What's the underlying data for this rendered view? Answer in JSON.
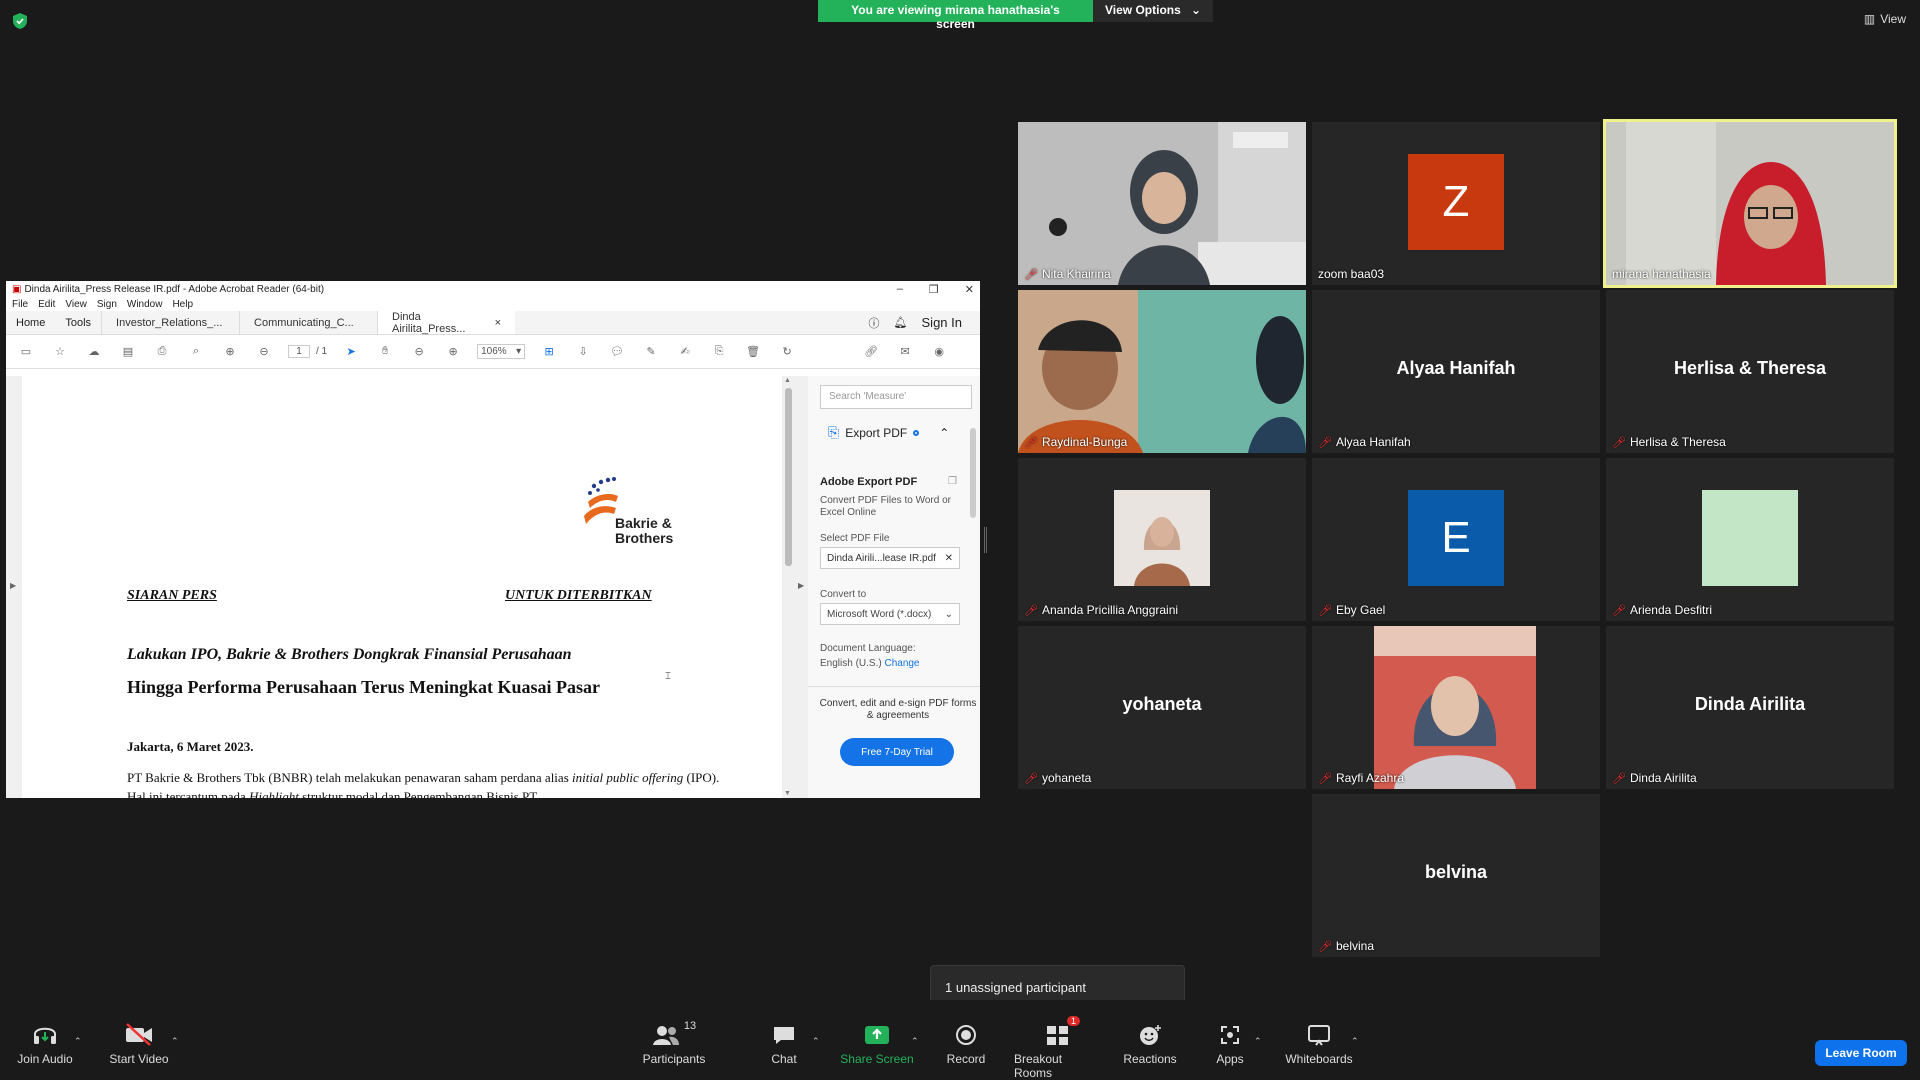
{
  "banner": {
    "viewing_text": "You are viewing mirana hanathasia's screen",
    "view_options": "View Options",
    "view_button": "View"
  },
  "acrobat": {
    "title": "Dinda Airilita_Press Release IR.pdf - Adobe Acrobat Reader (64-bit)",
    "menu": [
      "File",
      "Edit",
      "View",
      "Sign",
      "Window",
      "Help"
    ],
    "home": "Home",
    "tools": "Tools",
    "tabs": [
      "Investor_Relations_...",
      "Communicating_C...",
      "Dinda Airilita_Press..."
    ],
    "sign_in": "Sign In",
    "page_current": "1",
    "page_total": "/ 1",
    "zoom": "106%",
    "document": {
      "logo_line1": "Bakrie &",
      "logo_line2": "Brothers",
      "left_heading": "SIARAN PERS",
      "right_heading": "UNTUK DITERBITKAN",
      "headline1": "Lakukan IPO, Bakrie & Brothers Dongkrak  Finansial Perusahaan",
      "headline2": "Hingga Performa Perusahaan Terus Meningkat Kuasai Pasar",
      "dateline": "Jakarta, 6 Maret 2023.",
      "body_a": "PT Bakrie & Brothers Tbk (BNBR) telah melakukan penawaran saham perdana alias ",
      "body_b": "initial public offering",
      "body_c": " (IPO). Hal ini tercantum pada ",
      "body_d": "Highlight",
      "body_e": " struktur modal dan Pengembangan Bisnis PT"
    },
    "panel": {
      "search_placeholder": "Search 'Measure'",
      "export_pdf": "Export PDF",
      "adobe_export_title": "Adobe Export PDF",
      "adobe_export_desc": "Convert PDF Files to Word or Excel Online",
      "select_pdf": "Select PDF File",
      "file_name": "Dinda Airili...lease IR.pdf",
      "convert_to": "Convert to",
      "convert_value": "Microsoft Word (*.docx)",
      "doc_language": "Document Language:",
      "language": "English (U.S.)",
      "change": "Change",
      "promo": "Convert, edit and e-sign PDF forms & agreements",
      "trial": "Free 7-Day Trial"
    }
  },
  "participants": [
    {
      "name": "Nita Khairina",
      "muted": true
    },
    {
      "name": "zoom baa03",
      "muted": false,
      "letter": "Z",
      "color": "#c8390f"
    },
    {
      "name": "mirana hanathasia",
      "muted": false,
      "active": true
    },
    {
      "name": "Raydinal-Bunga",
      "muted": true
    },
    {
      "name": "Alyaa Hanifah",
      "muted": true,
      "display": "Alyaa Hanifah"
    },
    {
      "name": "Herlisa & Theresa",
      "muted": true,
      "display": "Herlisa & Theresa"
    },
    {
      "name": "Ananda Pricillia Anggraini",
      "muted": true
    },
    {
      "name": "Eby Gael",
      "muted": true,
      "letter": "E",
      "color": "#0b5bab"
    },
    {
      "name": "Arienda Desfitri",
      "muted": true,
      "color": "#c3e6c6"
    },
    {
      "name": "yohaneta",
      "muted": true,
      "display": "yohaneta"
    },
    {
      "name": "Rayfi Azahra",
      "muted": true
    },
    {
      "name": "Dinda Airilita",
      "muted": true,
      "display": "Dinda Airilita"
    },
    {
      "name": "belvina",
      "muted": true,
      "display": "belvina"
    }
  ],
  "toast": "1 unassigned participant",
  "toolbar": {
    "join_audio": "Join Audio",
    "start_video": "Start Video",
    "participants": "Participants",
    "participants_count": "13",
    "chat": "Chat",
    "share_screen": "Share Screen",
    "record": "Record",
    "breakout_rooms": "Breakout Rooms",
    "breakout_badge": "1",
    "reactions": "Reactions",
    "apps": "Apps",
    "whiteboards": "Whiteboards",
    "leave_room": "Leave Room"
  },
  "colors": {
    "accent_green": "#23b25a",
    "accent_blue": "#0e72ed",
    "active_speaker": "#f0f08c",
    "muted_red": "#e33333"
  }
}
